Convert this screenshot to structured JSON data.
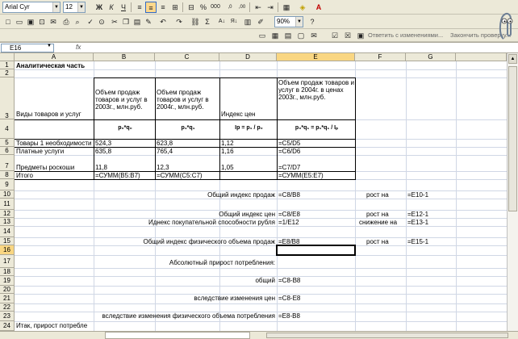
{
  "toolbar": {
    "font_name": "Arial Cyr",
    "font_size": "12",
    "zoom": "90%",
    "reply_with_changes": "Ответить с изменениями...",
    "end_review": "Закончить проверку..."
  },
  "formula_bar": {
    "name_box": "E16",
    "fx": "fx",
    "formula": ""
  },
  "columns": [
    "A",
    "B",
    "C",
    "D",
    "E",
    "F",
    "G"
  ],
  "rows": [
    "1",
    "2",
    "3",
    "4",
    "5",
    "6",
    "7",
    "8",
    "9",
    "10",
    "11",
    "12",
    "13",
    "14",
    "15",
    "16",
    "17",
    "18",
    "19",
    "20",
    "21",
    "22",
    "23",
    "24"
  ],
  "sheet": {
    "a1": "Аналитическая часть",
    "a3": "Виды товаров и услуг",
    "b3": "Объем продаж товаров и услуг в 2003г., млн.руб.",
    "c3": "Объем продаж товаров и услуг в 2004г., млн.руб.",
    "d3": "Индекс цен",
    "e3": "Объем продаж товаров и услуг в 2004г. в ценах 2003г., млн.руб.",
    "b4": "p₀*q₀",
    "c4": "p₁*q₁",
    "d4": "Ip = p₁ / p₀",
    "e4": "p₀*q₁ = p₁*q₁ / Iₚ",
    "a5": "Товары 1 необходимости",
    "b5": "524,3",
    "c5": "623,8",
    "d5": "1,12",
    "e5": "=C5/D5",
    "a6": "Платные услуги",
    "b6": "635,8",
    "c6": "765,4",
    "d6": "1,16",
    "e6": "=C6/D6",
    "a7": "Предметы роскоши",
    "b7": "11,8",
    "c7": "12,3",
    "d7": "1,05",
    "e7": "=C7/D7",
    "a8": "Итого",
    "b8": "=СУММ(B5:B7)",
    "c8": "=СУММ(C5:C7)",
    "e8": "=СУММ(E5:E7)",
    "d10": "Общий индекс продаж",
    "e10": "=C8/B8",
    "f10": "рост на",
    "g10": "=E10-1",
    "d12": "Общий индекс цен",
    "e12": "=C8/E8",
    "f12": "рост на",
    "g12": "=E12-1",
    "d13": "Иднекс покупательной способности рубля",
    "e13": "=1/E12",
    "f13": "снижение на",
    "g13": "=E13-1",
    "d15": "Общий индекс физического объема продаж",
    "e15": "=E8/B8",
    "f15": "рост на",
    "g15": "=E15-1",
    "d17": "Абсолютный прирост потребления:",
    "d19": "общий",
    "e19": "=C8-B8",
    "d21": "вследствие изменения цен",
    "e21": "=C8-E8",
    "d23": "вследствие изменения физического объема потребления",
    "e23": "=E8-B8",
    "a24": "Итак, прирост потребле"
  },
  "colors": {
    "selection": "#f9d682",
    "grid": "#d0d7e5",
    "chrome": "#ece9d8"
  }
}
